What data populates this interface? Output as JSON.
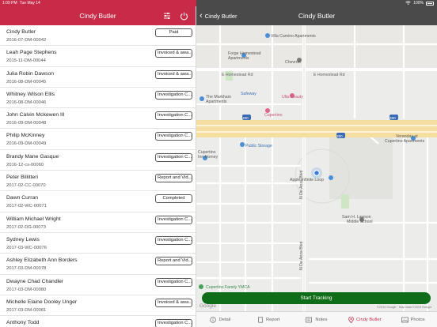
{
  "status_bar": {
    "time": "1:09 PM",
    "date": "Tue May 14",
    "battery": "100%"
  },
  "left_header": {
    "title": "Cindy Butler"
  },
  "cases": [
    {
      "name": "Cindy Butler",
      "id": "2016-07-DM-00042",
      "status": "Paid"
    },
    {
      "name": "Leah Page Stephens",
      "id": "2015-11-DM-00044",
      "status": "Invoiced & awa..."
    },
    {
      "name": "Julia Robin Dawson",
      "id": "2016-08-DM-00045",
      "status": "Invoiced & awa..."
    },
    {
      "name": "Whitney Wilson Ellis",
      "id": "2016-08-DM-00046",
      "status": "Investigation C..."
    },
    {
      "name": "John Calvin Mckewen III",
      "id": "2016-09-DM-00048",
      "status": "Investigation C..."
    },
    {
      "name": "Philip McKinney",
      "id": "2016-09-DM-00049",
      "status": "Investigation C..."
    },
    {
      "name": "Brandy Mane Gasque",
      "id": "2016-12-cs-00060",
      "status": "Investigation C..."
    },
    {
      "name": "Peter Billitteri",
      "id": "2017-02-CC-00070",
      "status": "Report and Vid..."
    },
    {
      "name": "Dawn Curran",
      "id": "2017-02-WC-00071",
      "status": "Completed"
    },
    {
      "name": "William Michael Wright",
      "id": "2017-02-DG-00073",
      "status": "Investigation C..."
    },
    {
      "name": "Sydney Lewis",
      "id": "2017-03-WC-00076",
      "status": "Investigation C..."
    },
    {
      "name": "Ashley Elizabeth Ann Borders",
      "id": "2017-03-DM-00078",
      "status": "Report and Vid..."
    },
    {
      "name": "Dwayne Chad Chandler",
      "id": "2017-03-DM-00080",
      "status": "Investigation C..."
    },
    {
      "name": "Michelle Elaine Dooley Unger",
      "id": "2017-03-DM-00081",
      "status": "Invoiced & awa..."
    },
    {
      "name": "Anthony Todd",
      "id": "",
      "status": "Investigation C..."
    }
  ],
  "right_header": {
    "back_label": "Cindy Butler",
    "title": "Cindy Butler"
  },
  "map": {
    "labels": {
      "villa_camino": "Villa Camino Apartments",
      "forge_homestead": "Forge Homestead",
      "apartments": "Apartments",
      "chevron": "Chevron",
      "e_homestead_1": "E Homestead Rd",
      "e_homestead_2": "E Homestead Rd",
      "safeway": "Safeway",
      "ulta": "Ulta Beauty",
      "markham": "The Markham",
      "markham2": "Apartments",
      "cupertino": "Cupertino",
      "verandas": "Verandas at",
      "verandas2": "Cupertino Apartments",
      "public_storage": "Public Storage",
      "cupertino_home": "Cupertino",
      "cupertino_home2": "Inn Homey",
      "apple_loop": "Apple Infinite Loop",
      "sam_lawson": "Sam H. Lawson",
      "sam_lawson2": "Middle School",
      "ymca": "Cupertino Family YMCA",
      "n_de_anza": "N De Anza Blvd",
      "n_de_anza2": "N De Anza Blvd",
      "google": "Google",
      "attribution": "©2019 Google · Map data ©2019 Google",
      "i280_a": "280",
      "i280_b": "280",
      "i280_c": "280"
    }
  },
  "start_tracking_label": "Start Tracking",
  "tabs": [
    {
      "label": "Detail",
      "icon": "info-icon"
    },
    {
      "label": "Report",
      "icon": "report-icon"
    },
    {
      "label": "Notes",
      "icon": "notes-icon"
    },
    {
      "label": "Cindy Butler",
      "icon": "location-pin-icon",
      "active": true
    },
    {
      "label": "Photos",
      "icon": "photos-icon"
    }
  ],
  "colors": {
    "accent_red": "#c72b47",
    "dark_header": "#4a4a4a",
    "tracking_green": "#0f6d1a"
  }
}
